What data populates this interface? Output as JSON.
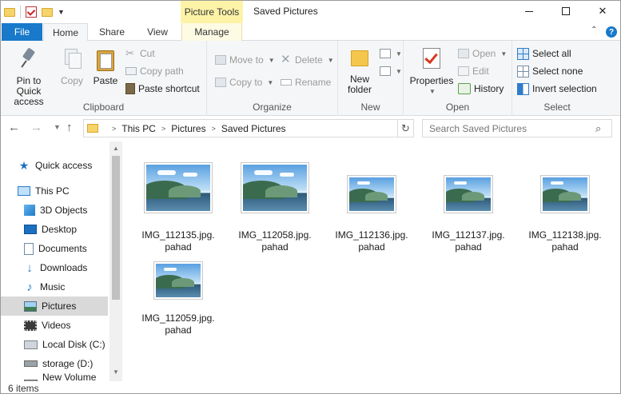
{
  "window": {
    "title": "Saved Pictures",
    "context_tab": "Picture Tools"
  },
  "ribbon_tabs": {
    "file": "File",
    "home": "Home",
    "share": "Share",
    "view": "View",
    "manage": "Manage"
  },
  "clipboard": {
    "pin": "Pin to Quick access",
    "copy": "Copy",
    "paste": "Paste",
    "cut": "Cut",
    "copy_path": "Copy path",
    "paste_shortcut": "Paste shortcut",
    "label": "Clipboard"
  },
  "organize": {
    "move_to": "Move to",
    "copy_to": "Copy to",
    "delete": "Delete",
    "rename": "Rename",
    "label": "Organize"
  },
  "new_group": {
    "new_folder": "New folder",
    "label": "New"
  },
  "open_group": {
    "properties": "Properties",
    "open": "Open",
    "edit": "Edit",
    "history": "History",
    "label": "Open"
  },
  "select_group": {
    "select_all": "Select all",
    "select_none": "Select none",
    "invert": "Invert selection",
    "label": "Select"
  },
  "address": {
    "crumbs": [
      "This PC",
      "Pictures",
      "Saved Pictures"
    ],
    "search_placeholder": "Search Saved Pictures"
  },
  "nav_pane": {
    "items": [
      {
        "label": "Quick access",
        "icon": "star-icon"
      },
      {
        "label": "This PC",
        "icon": "computer-icon"
      },
      {
        "label": "3D Objects",
        "icon": "cube-icon"
      },
      {
        "label": "Desktop",
        "icon": "desktop-icon"
      },
      {
        "label": "Documents",
        "icon": "document-icon"
      },
      {
        "label": "Downloads",
        "icon": "download-icon"
      },
      {
        "label": "Music",
        "icon": "music-icon"
      },
      {
        "label": "Pictures",
        "icon": "pictures-icon"
      },
      {
        "label": "Videos",
        "icon": "video-icon"
      },
      {
        "label": "Local Disk (C:)",
        "icon": "disk-icon"
      },
      {
        "label": "storage (D:)",
        "icon": "drive-icon"
      },
      {
        "label": "New Volume (E:)",
        "icon": "drive-icon"
      }
    ],
    "selected": "Pictures"
  },
  "files": [
    {
      "line1": "IMG_112135.jpg.",
      "line2": "pahad"
    },
    {
      "line1": "IMG_112058.jpg.",
      "line2": "pahad"
    },
    {
      "line1": "IMG_112136.jpg.",
      "line2": "pahad"
    },
    {
      "line1": "IMG_112137.jpg.",
      "line2": "pahad"
    },
    {
      "line1": "IMG_112138.jpg.",
      "line2": "pahad"
    },
    {
      "line1": "IMG_112059.jpg.",
      "line2": "pahad"
    }
  ],
  "status": {
    "items_count": "6 items"
  },
  "colors": {
    "accent": "#1979ca",
    "context_tab": "#fcf3a7",
    "selection": "#d9d9d9"
  }
}
